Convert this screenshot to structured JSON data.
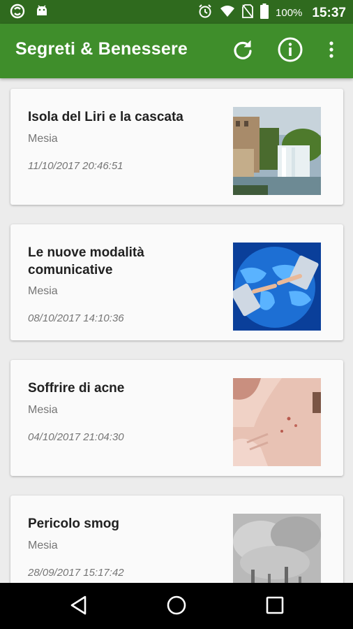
{
  "status_bar": {
    "battery_percent": "100%",
    "time": "15:37",
    "icons": [
      "app-sync-icon",
      "android-icon",
      "alarm-icon",
      "wifi-icon",
      "no-sim-icon",
      "battery-icon"
    ]
  },
  "app_bar": {
    "title": "Segreti & Benessere",
    "actions": [
      "refresh-icon",
      "info-icon",
      "overflow-menu-icon"
    ]
  },
  "colors": {
    "status_bar": "#2f6a1e",
    "app_bar": "#3f8e2b",
    "background": "#ececec",
    "card": "#fafafa"
  },
  "articles": [
    {
      "title": "Isola del Liri e la cascata",
      "author": "Mesia",
      "date": "11/10/2017 20:46:51",
      "image": "waterfall-town-image"
    },
    {
      "title": "Le nuove modalità comunicative",
      "author": "Mesia",
      "date": "08/10/2017 14:10:36",
      "image": "phones-world-map-image"
    },
    {
      "title": "Soffrire di acne",
      "author": "Mesia",
      "date": "04/10/2017 21:04:30",
      "image": "skin-acne-image"
    },
    {
      "title": "Pericolo smog",
      "author": "Mesia",
      "date": "28/09/2017 15:17:42",
      "image": "smokestacks-image"
    }
  ],
  "nav_bar": [
    "back-icon",
    "home-icon",
    "recents-icon"
  ]
}
